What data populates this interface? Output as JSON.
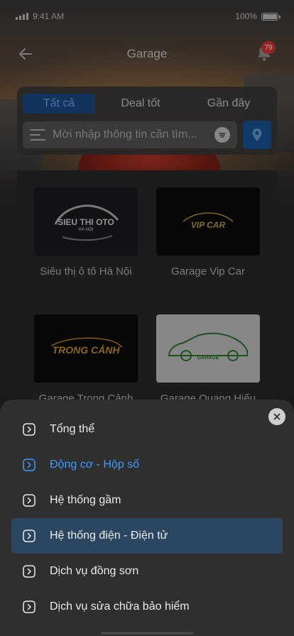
{
  "status_bar": {
    "time": "9:41 AM",
    "battery": "100%"
  },
  "header": {
    "title": "Garage",
    "notification_count": "79"
  },
  "tabs": [
    {
      "label": "Tất cả",
      "active": true
    },
    {
      "label": "Deal tốt",
      "active": false
    },
    {
      "label": "Gần đây",
      "active": false
    }
  ],
  "search": {
    "placeholder": "Mời nhập thông tin cần tìm..."
  },
  "garages": [
    {
      "name": "Siêu thị ô tô Hà Nội",
      "logo_main": "SIEU THI OTO",
      "logo_sub": "HÀ NỘI"
    },
    {
      "name": "Garage Vip Car",
      "logo_main": "VIP CAR"
    },
    {
      "name": "Garage Trọng Cảnh",
      "logo_main": "TRONG CẢNH"
    },
    {
      "name": "Garage Quang Hiếu",
      "logo_main": "GARAGE"
    }
  ],
  "service_menu": {
    "items": [
      {
        "label": "Tổng thể",
        "state": "normal"
      },
      {
        "label": "Động cơ - Hộp số",
        "state": "accent"
      },
      {
        "label": "Hệ thống gầm",
        "state": "normal"
      },
      {
        "label": "Hệ thống điện - Điện tử",
        "state": "highlight"
      },
      {
        "label": "Dịch vụ đồng sơn",
        "state": "normal"
      },
      {
        "label": "Dịch vụ sửa chữa bảo hiểm",
        "state": "normal"
      }
    ]
  },
  "colors": {
    "accent": "#3d9bff",
    "highlight_row": "#2b4660",
    "tab_active": "#1d4f8c",
    "badge": "#e53935"
  }
}
